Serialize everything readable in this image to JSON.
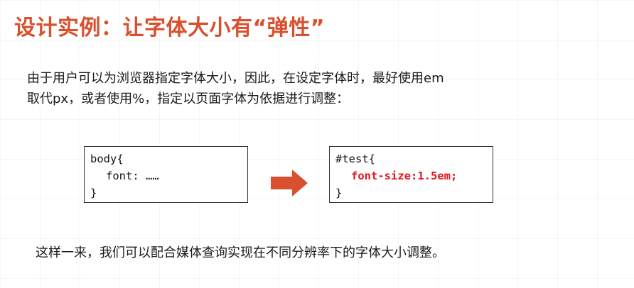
{
  "title": "设计实例：让字体大小有“弹性”",
  "intro": {
    "line1": "由于用户可以为浏览器指定字体大小，因此，在设定字体时，最好使用em",
    "line2": "取代px，或者使用%，指定以页面字体为依据进行调整："
  },
  "code_body": {
    "line1": "body{",
    "line2": "font: ……",
    "line3": "}"
  },
  "code_test": {
    "line1": "#test{",
    "line2": "font-size:1.5em;",
    "line3": "}"
  },
  "arrow": {
    "icon": "right-arrow-icon",
    "color": "#d9502e"
  },
  "closing": "这样一来，我们可以配合媒体查询实现在不同分辨率下的字体大小调整。",
  "colors": {
    "title": "#d9502e",
    "code_highlight": "#e0161e",
    "text": "#1a1a1a"
  }
}
